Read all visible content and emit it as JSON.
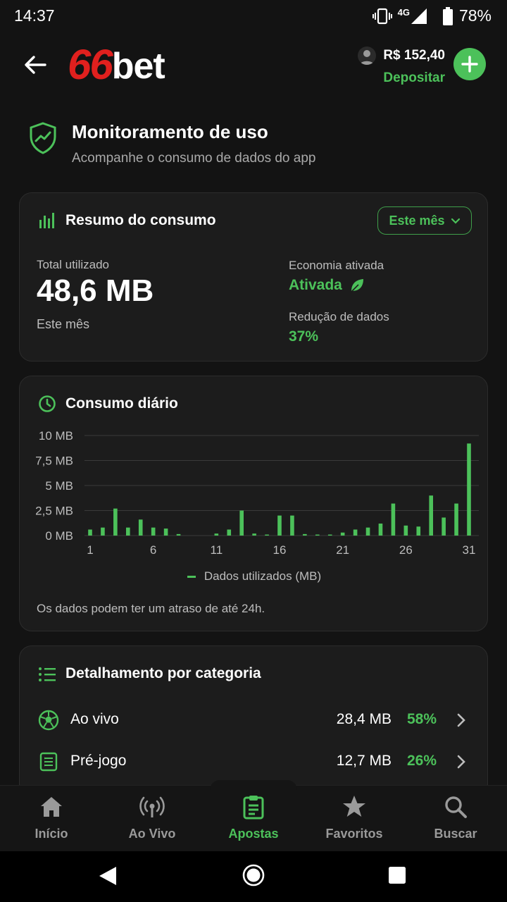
{
  "status_bar": {
    "time": "14:37",
    "network": "4G",
    "battery": "78%"
  },
  "app_bar": {
    "logo_number": "66",
    "logo_word": "bet",
    "balance": "R$ 152,40",
    "deposit_label": "Depositar"
  },
  "page": {
    "title": "Monitoramento de uso",
    "subtitle": "Acompanhe o consumo de dados do app"
  },
  "summary": {
    "title": "Resumo do consumo",
    "period_label": "Este mês",
    "total_label": "Total utilizado",
    "total_value": "48,6 MB",
    "total_period": "Este mês",
    "economy_label": "Economia ativada",
    "economy_value": "Ativada",
    "reduction_label": "Redução de dados",
    "reduction_value": "37%"
  },
  "daily": {
    "title": "Consumo diário",
    "note": "Os dados podem ter um atraso de até 24h."
  },
  "chart_data": {
    "type": "bar",
    "x": [
      1,
      2,
      3,
      4,
      5,
      6,
      7,
      8,
      9,
      10,
      11,
      12,
      13,
      14,
      15,
      16,
      17,
      18,
      19,
      20,
      21,
      22,
      23,
      24,
      25,
      26,
      27,
      28,
      29,
      30,
      31
    ],
    "x_tick_labels": [
      "1",
      "6",
      "11",
      "16",
      "21",
      "26",
      "31"
    ],
    "series": [
      {
        "name": "Dados utilizados (MB)",
        "values": [
          0.6,
          0.8,
          2.7,
          0.8,
          1.6,
          0.8,
          0.7,
          0.15,
          0,
          0,
          0.2,
          0.6,
          2.5,
          0.2,
          0.1,
          2.0,
          2.0,
          0.15,
          0.1,
          0.1,
          0.3,
          0.6,
          0.8,
          1.2,
          3.2,
          1.0,
          0.9,
          4.0,
          1.8,
          3.2,
          9.2
        ]
      }
    ],
    "y_tick_labels": [
      "0 MB",
      "2,5 MB",
      "5 MB",
      "7,5 MB",
      "10 MB"
    ],
    "ylim": [
      0,
      10
    ],
    "grid": true,
    "legend_position": "bottom",
    "color": "#4cc15a"
  },
  "categories": {
    "title": "Detalhamento por categoria",
    "items": [
      {
        "name": "Ao vivo",
        "size": "28,4 MB",
        "percent": "58%",
        "icon": "soccer-ball-icon"
      },
      {
        "name": "Pré-jogo",
        "size": "12,7 MB",
        "percent": "26%",
        "icon": "list-doc-icon"
      }
    ]
  },
  "bottom_nav": [
    {
      "label": "Início",
      "icon": "home-icon",
      "active": false
    },
    {
      "label": "Ao Vivo",
      "icon": "broadcast-icon",
      "active": false
    },
    {
      "label": "Apostas",
      "icon": "clipboard-icon",
      "active": true
    },
    {
      "label": "Favoritos",
      "icon": "star-icon",
      "active": false
    },
    {
      "label": "Buscar",
      "icon": "search-icon",
      "active": false
    }
  ],
  "colors": {
    "accent": "#4cc15a",
    "brand_red": "#e0201e",
    "background": "#131313",
    "card": "#1c1c1c"
  }
}
